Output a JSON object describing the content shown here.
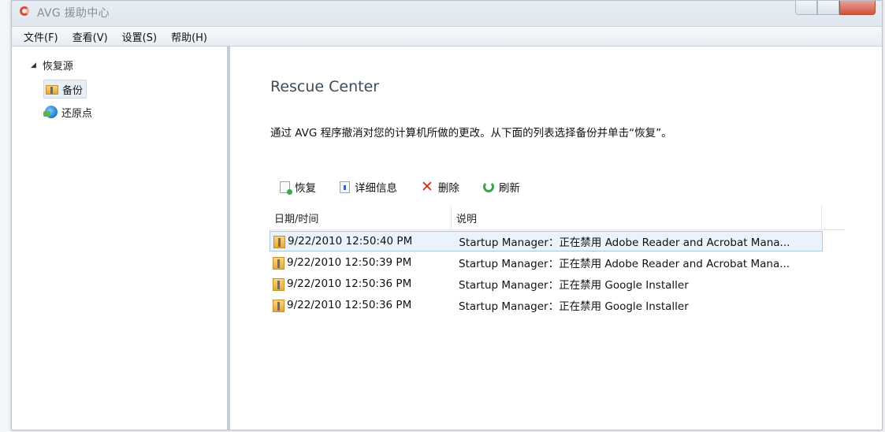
{
  "window": {
    "title": "AVG 援助中心"
  },
  "menubar": {
    "items": [
      "文件(F)",
      "查看(V)",
      "设置(S)",
      "帮助(H)"
    ]
  },
  "sidebar": {
    "root": "恢复源",
    "children": [
      {
        "label": "备份",
        "selected": true,
        "icon": "folder-icon"
      },
      {
        "label": "还原点",
        "selected": false,
        "icon": "restore-point-icon"
      }
    ]
  },
  "main": {
    "heading": "Rescue Center",
    "description": "通过 AVG 程序撤消对您的计算机所做的更改。从下面的列表选择备份并单击“恢复”。",
    "toolbar": {
      "restore": "恢复",
      "details": "详细信息",
      "delete": "删除",
      "refresh": "刷新"
    },
    "table": {
      "headers": [
        "日期/时间",
        "说明"
      ],
      "rows": [
        {
          "datetime": "9/22/2010 12:50:40 PM",
          "description": "Startup Manager：正在禁用 Adobe Reader and Acrobat Mana...",
          "selected": true
        },
        {
          "datetime": "9/22/2010 12:50:39 PM",
          "description": "Startup Manager：正在禁用 Adobe Reader and Acrobat Mana...",
          "selected": false
        },
        {
          "datetime": "9/22/2010 12:50:36 PM",
          "description": "Startup Manager：正在禁用 Google Installer",
          "selected": false
        },
        {
          "datetime": "9/22/2010 12:50:36 PM",
          "description": "Startup Manager：正在禁用 Google Installer",
          "selected": false
        }
      ]
    }
  },
  "colors": {
    "accent": "#3d4a58",
    "delete": "#e02b1a",
    "refresh": "#3aa644",
    "selection": "#eaf2fb"
  }
}
